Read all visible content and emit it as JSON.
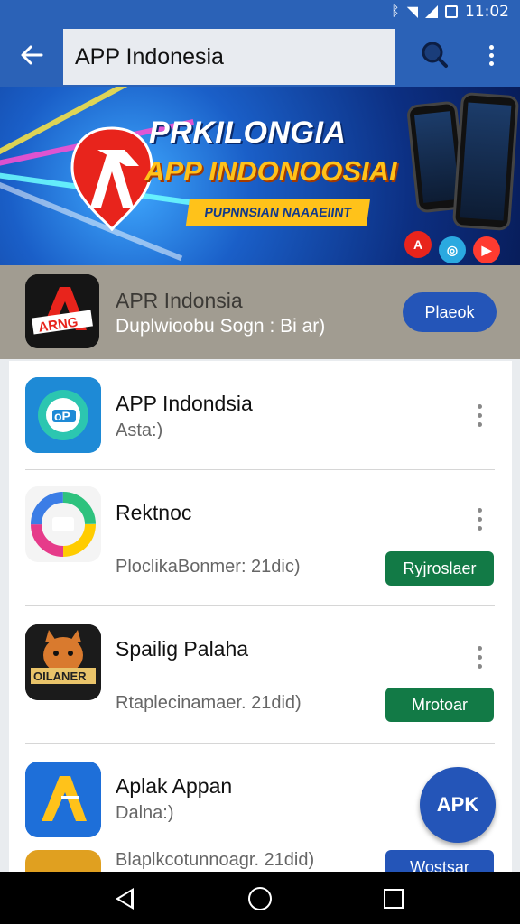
{
  "status_bar": {
    "time": "11:02"
  },
  "app_bar": {
    "back_icon": "arrow-left-icon",
    "search_value": "APP Indonesia",
    "search_icon": "search-icon",
    "more_icon": "more-vertical-icon"
  },
  "banner": {
    "title": "PRKILONGIA",
    "subtitle": "APP INDONOOSIAI",
    "tagline": "PUPNNSIAN NAAAEIINT"
  },
  "featured": {
    "name": "APR Indonsia",
    "subtitle": "Duplwioobu Sogn : Bi ar)",
    "button_label": "Plaeok"
  },
  "apps": [
    {
      "name": "APP Indondsia",
      "subtitle": "Asta:)",
      "button_label": ""
    },
    {
      "name": "Rektnoc",
      "subtitle": "PloclikaBonmer: 21dic)",
      "button_label": "Ryjroslaer"
    },
    {
      "name": "Spailig Palaha",
      "subtitle": "Rtaplecinamaer. 21did)",
      "button_label": "Mrotoar"
    },
    {
      "name": "Aplak Appan",
      "subtitle": "Dalna:)",
      "subtitle2": "Blaplkcotunnoagr. 21did)",
      "button_label": "Wostsar"
    }
  ],
  "fab": {
    "label": "APK"
  },
  "nav": {
    "back_icon": "nav-back-icon",
    "home_icon": "nav-home-icon",
    "recent_icon": "nav-recents-icon"
  },
  "colors": {
    "primary": "#2b62b7",
    "accent_blue": "#2455b8",
    "green": "#127a46"
  }
}
